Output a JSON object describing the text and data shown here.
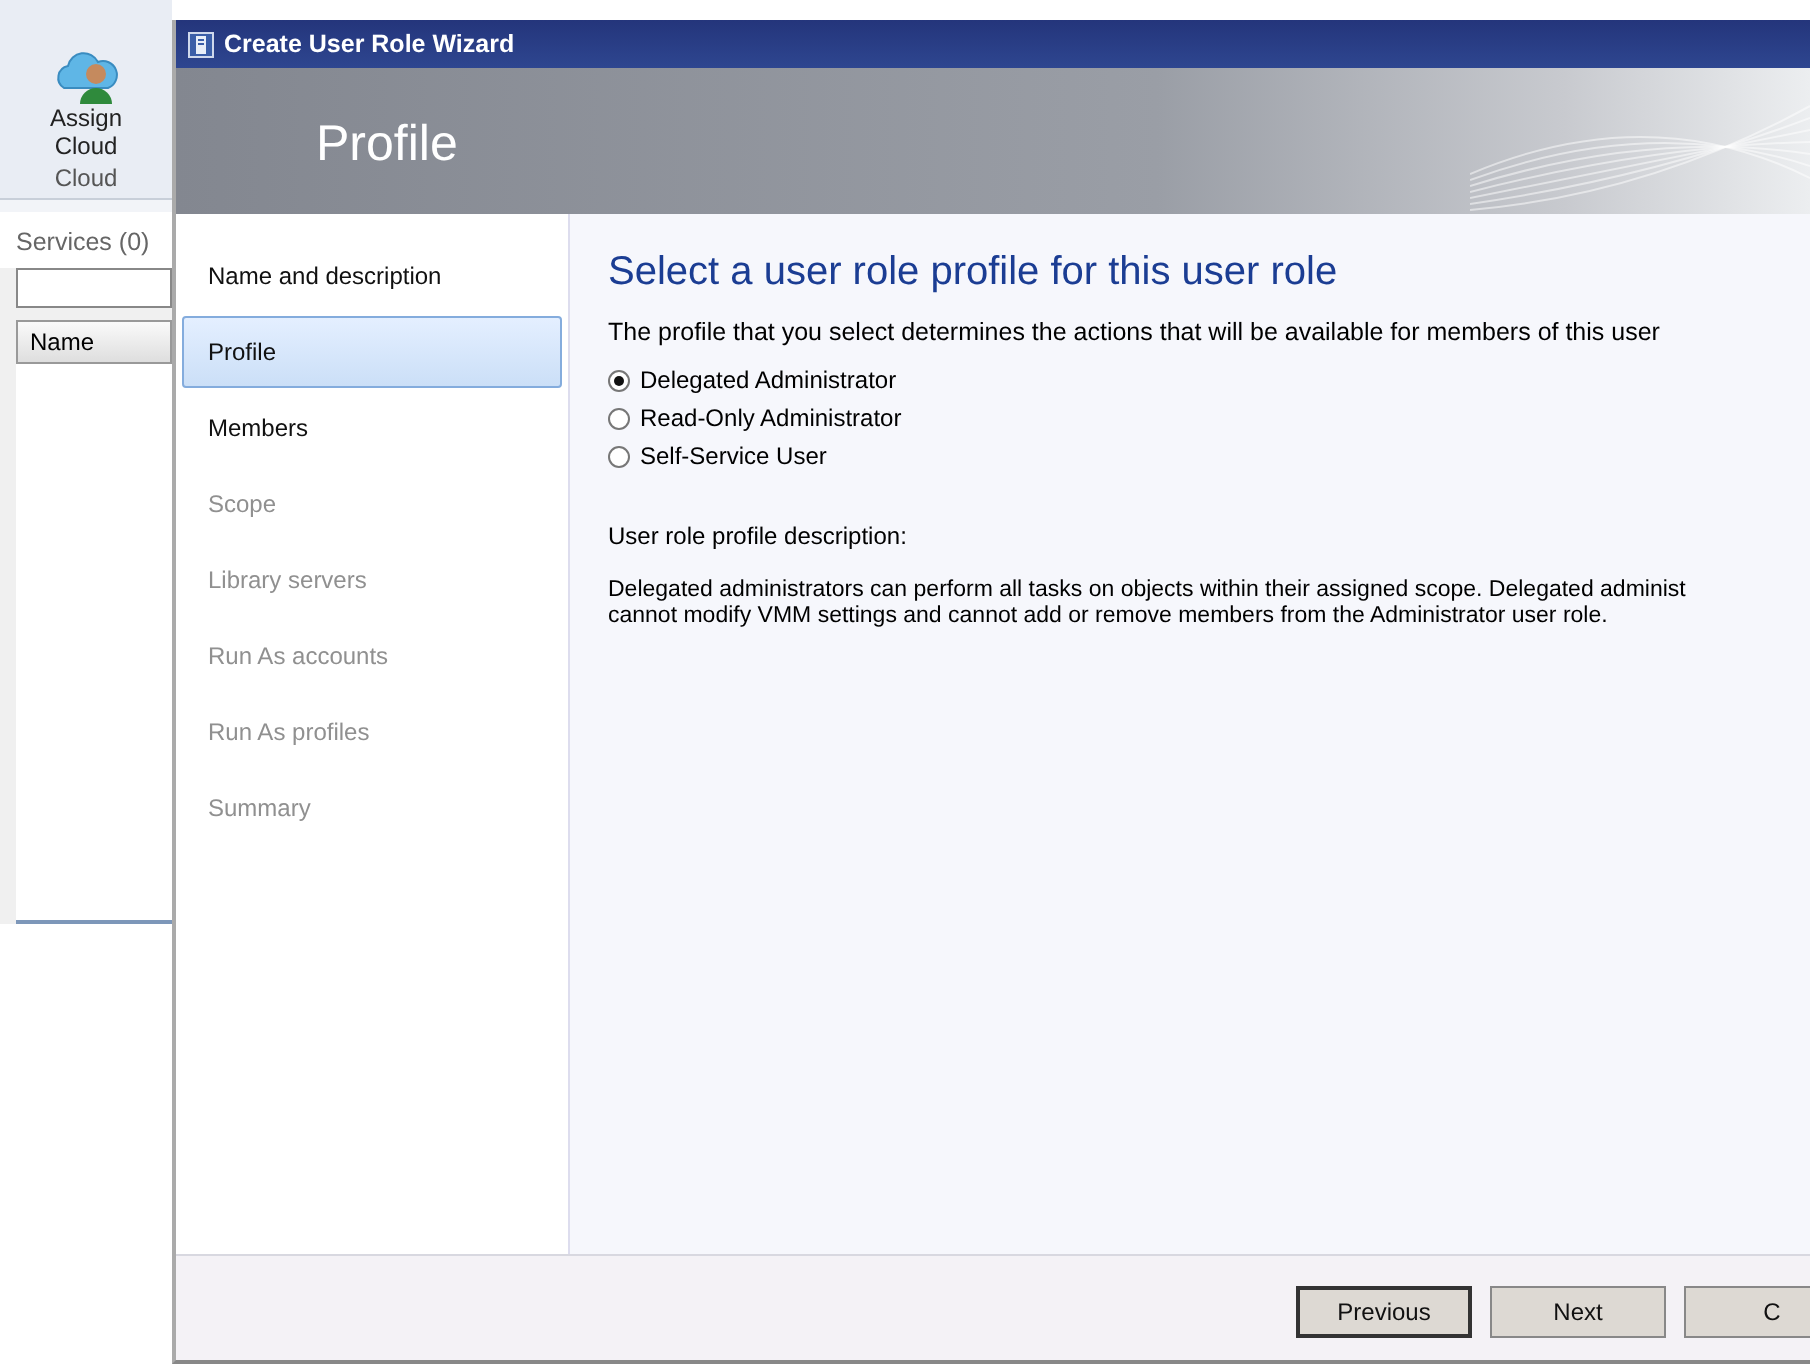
{
  "background_app": {
    "ribbon_button": "Assign\nCloud",
    "ribbon_group": "Cloud",
    "pane_title": "Services (0)",
    "column_header": "Name"
  },
  "window": {
    "title": "Create User Role Wizard",
    "header": "Profile"
  },
  "steps": [
    {
      "label": "Name and description",
      "selected": false,
      "disabled": false
    },
    {
      "label": "Profile",
      "selected": true,
      "disabled": false
    },
    {
      "label": "Members",
      "selected": false,
      "disabled": false
    },
    {
      "label": "Scope",
      "selected": false,
      "disabled": true
    },
    {
      "label": "Library servers",
      "selected": false,
      "disabled": true
    },
    {
      "label": "Run As accounts",
      "selected": false,
      "disabled": true
    },
    {
      "label": "Run As profiles",
      "selected": false,
      "disabled": true
    },
    {
      "label": "Summary",
      "selected": false,
      "disabled": true
    }
  ],
  "content": {
    "heading": "Select a user role profile for this user role",
    "intro": "The profile that you select determines the actions that will be available for members of this user",
    "profiles": [
      {
        "label": "Delegated Administrator",
        "selected": true
      },
      {
        "label": "Read-Only Administrator",
        "selected": false
      },
      {
        "label": "Self-Service User",
        "selected": false
      }
    ],
    "description_label": "User role profile description:",
    "description": "Delegated administrators can perform all tasks on objects within their assigned scope. Delegated administ\ncannot modify VMM settings and cannot add or remove members from the Administrator user role."
  },
  "buttons": [
    {
      "label": "Previous",
      "default": true
    },
    {
      "label": "Next",
      "default": false
    },
    {
      "label": "C",
      "default": false
    }
  ]
}
